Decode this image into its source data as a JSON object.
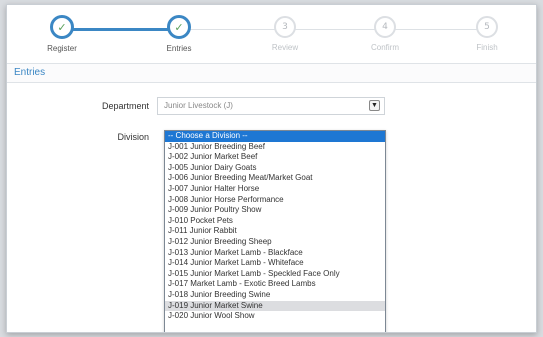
{
  "wizard": {
    "steps": [
      {
        "label": "Register",
        "status": "done",
        "icon": "check-icon",
        "glyph": "✓"
      },
      {
        "label": "Entries",
        "status": "done",
        "icon": "check-icon",
        "glyph": "✓"
      },
      {
        "label": "Review",
        "status": "todo",
        "number": "3"
      },
      {
        "label": "Confirm",
        "status": "todo",
        "number": "4"
      },
      {
        "label": "Finish",
        "status": "todo",
        "number": "5"
      }
    ]
  },
  "section": {
    "title": "Entries"
  },
  "form": {
    "department_label": "Department",
    "department_value": "Junior Livestock (J)",
    "division_label": "Division",
    "division_options": [
      "-- Choose a Division --",
      "J-001 Junior Breeding Beef",
      "J-002 Junior Market Beef",
      "J-005 Junior Dairy Goats",
      "J-006 Junior Breeding Meat/Market Goat",
      "J-007 Junior Halter Horse",
      "J-008 Junior Horse Performance",
      "J-009 Junior Poultry Show",
      "J-010 Pocket Pets",
      "J-011 Junior Rabbit",
      "J-012 Junior Breeding Sheep",
      "J-013 Junior Market Lamb - Blackface",
      "J-014 Junior Market Lamb - Whiteface",
      "J-015 Junior Market Lamb - Speckled Face Only",
      "J-017 Market Lamb - Exotic Breed Lambs",
      "J-018 Junior Breeding Swine",
      "J-019 Junior Market Swine",
      "J-020 Junior Wool Show"
    ],
    "selected_index": 0,
    "hover_index": 16
  },
  "colors": {
    "accent": "#3b87c4",
    "selected": "#1e77d3",
    "hover": "#dcdde0"
  }
}
